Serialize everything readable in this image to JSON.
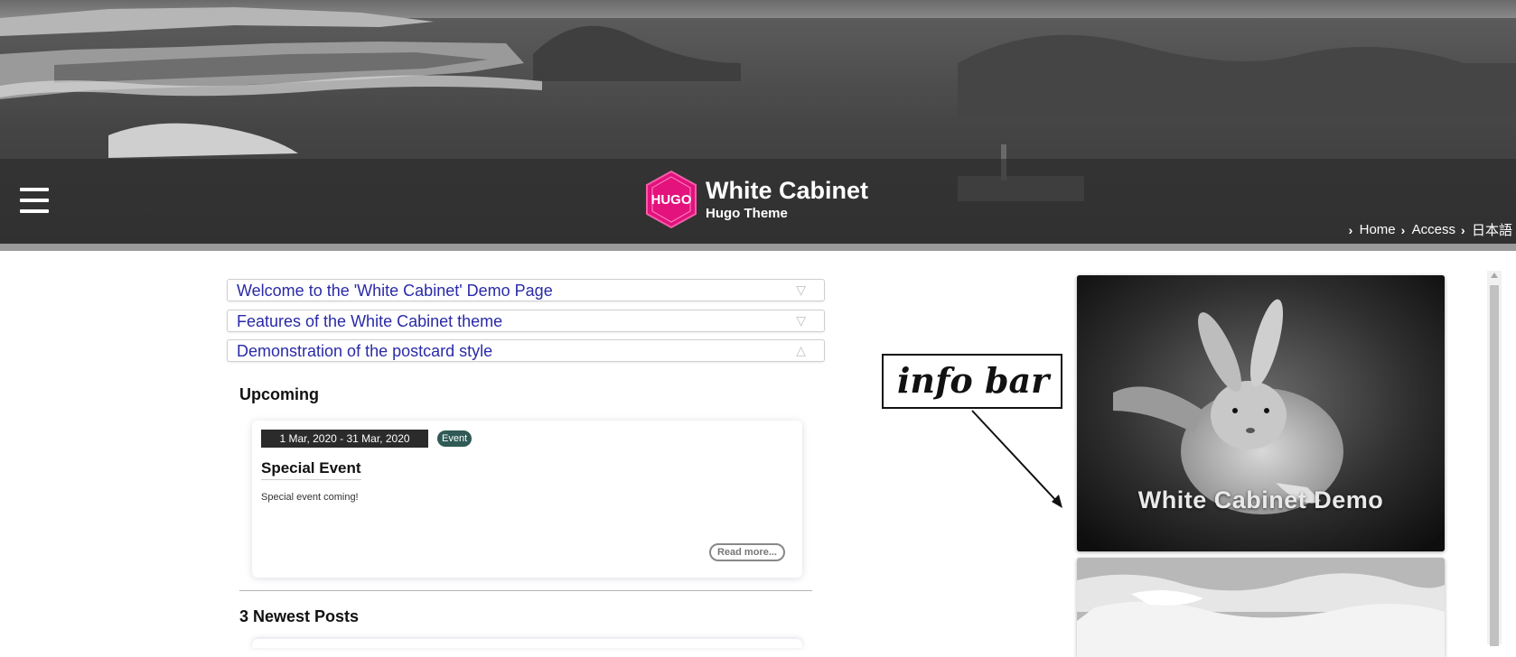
{
  "header": {
    "site_title": "White Cabinet",
    "site_subtitle": "Hugo Theme",
    "logo_text": "HUGO",
    "menu_icon": "hamburger-icon",
    "nav": [
      {
        "label": "Home"
      },
      {
        "label": "Access"
      },
      {
        "label": "日本語"
      }
    ]
  },
  "accordions": [
    {
      "label": "Welcome to the 'White Cabinet' Demo Page",
      "arrow": "▽",
      "state": "collapsed"
    },
    {
      "label": "Features of the White Cabinet theme",
      "arrow": "▽",
      "state": "collapsed"
    },
    {
      "label": "Demonstration of the postcard style",
      "arrow": "△",
      "state": "expanded"
    }
  ],
  "upcoming": {
    "heading": "Upcoming",
    "event": {
      "date_range": "1 Mar, 2020 - 31 Mar, 2020",
      "badge": "Event",
      "title": "Special Event",
      "description": "Special event coming!",
      "read_more": "Read more..."
    }
  },
  "newest_posts": {
    "heading": "3 Newest Posts"
  },
  "annotation": {
    "text": "info bar"
  },
  "sidebar": {
    "hero_caption": "White Cabinet Demo"
  },
  "colors": {
    "link": "#2a2aa8",
    "logo_pink": "#e3127d",
    "badge": "#2f5a55",
    "date_bg": "#2b2b2b"
  }
}
